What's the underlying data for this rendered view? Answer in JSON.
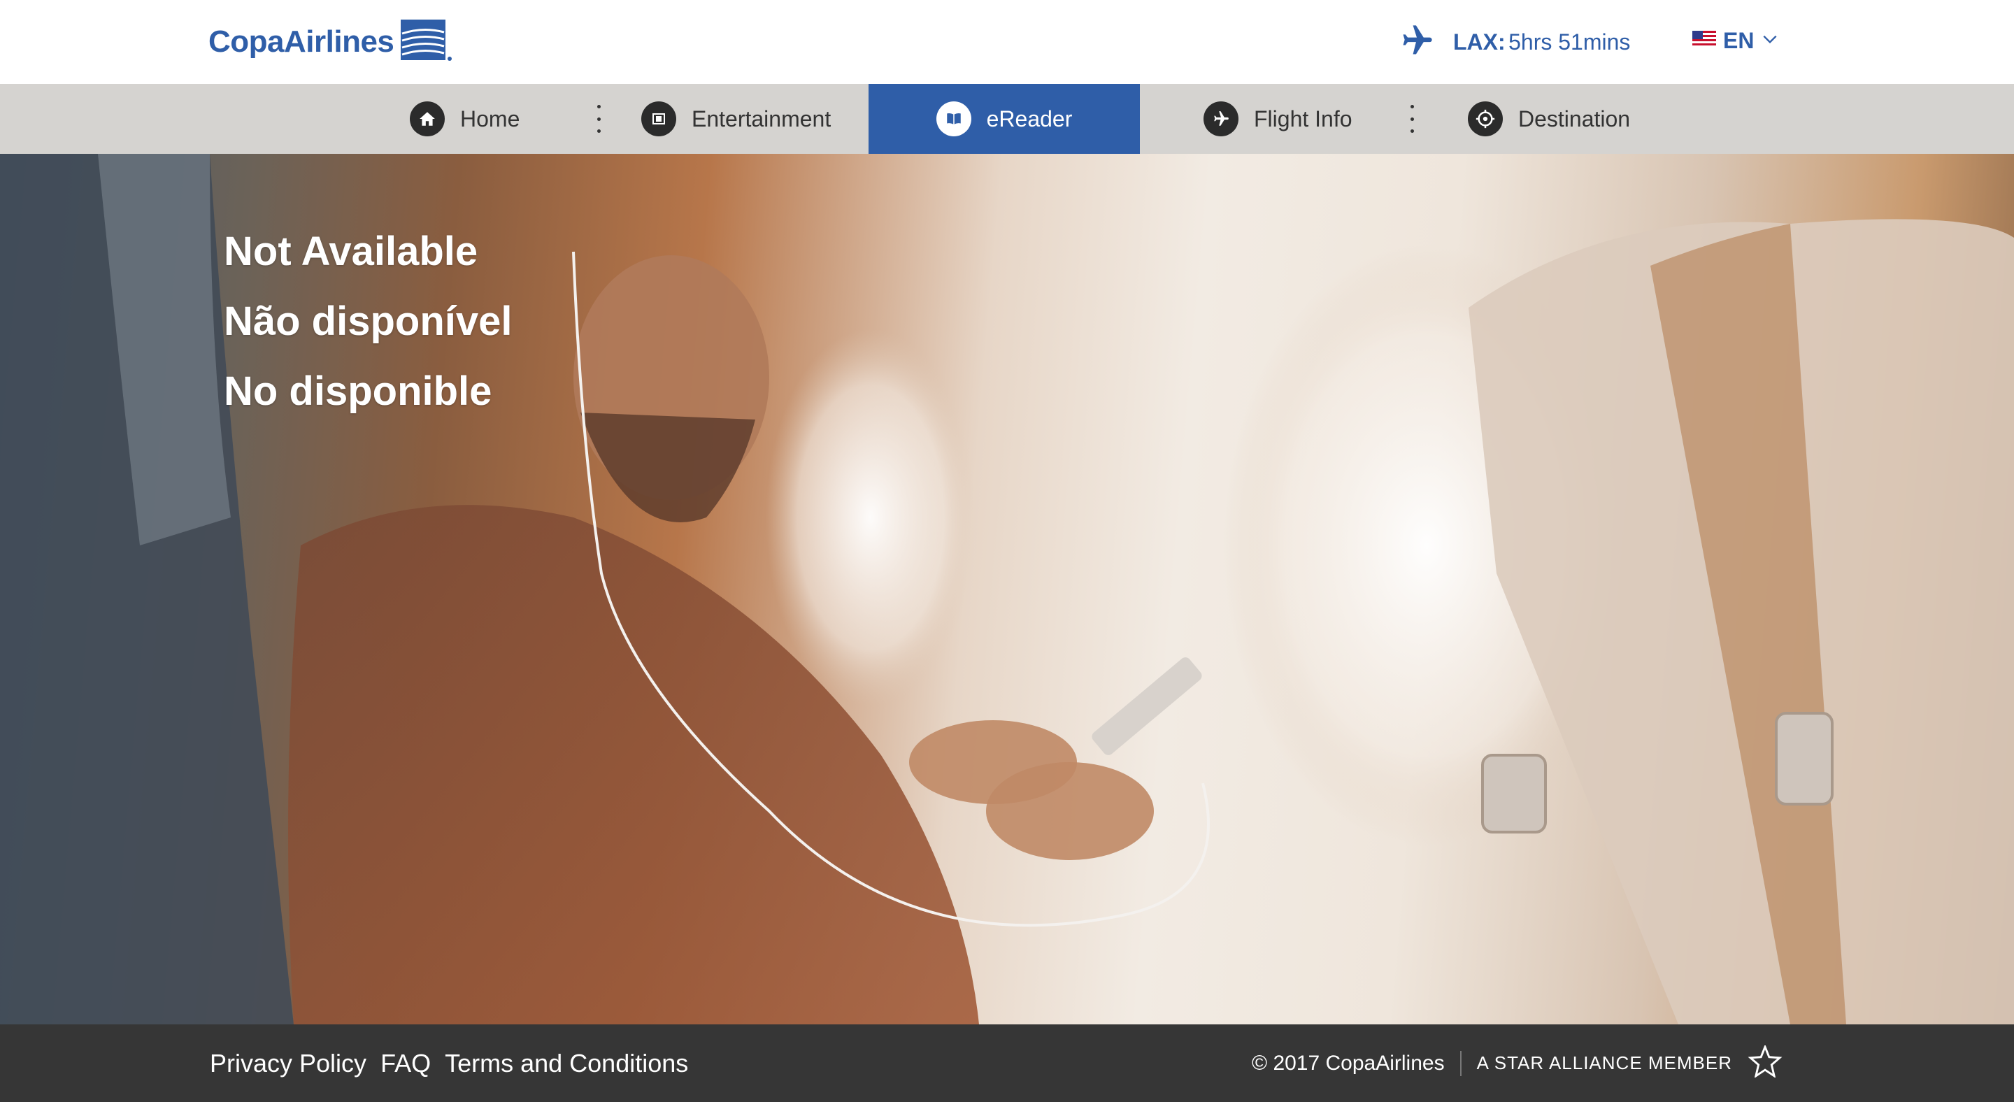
{
  "brand": {
    "name": "CopaAirlines",
    "logo_icon": "copa-globe-icon",
    "color": "#2f5ea8"
  },
  "flight": {
    "icon": "airplane-icon",
    "route": "LAX:",
    "time_remaining": "5hrs 51mins"
  },
  "language": {
    "flag_icon": "us-flag-icon",
    "code": "EN",
    "dropdown_icon": "chevron-down-icon"
  },
  "nav": {
    "items": [
      {
        "label": "Home",
        "icon": "home-icon"
      },
      {
        "label": "Entertainment",
        "icon": "film-icon"
      },
      {
        "label": "eReader",
        "icon": "book-icon",
        "active": true
      },
      {
        "label": "Flight Info",
        "icon": "airplane-icon"
      },
      {
        "label": "Destination",
        "icon": "target-icon"
      }
    ],
    "active_color": "#2f5ea8"
  },
  "hero": {
    "messages": [
      "Not Available",
      "Não disponível",
      "No disponible"
    ]
  },
  "footer": {
    "links": [
      "Privacy Policy",
      "FAQ",
      "Terms and Conditions"
    ],
    "copyright": "© 2017 CopaAirlines",
    "alliance": "A STAR ALLIANCE MEMBER",
    "alliance_icon": "star-alliance-icon"
  }
}
